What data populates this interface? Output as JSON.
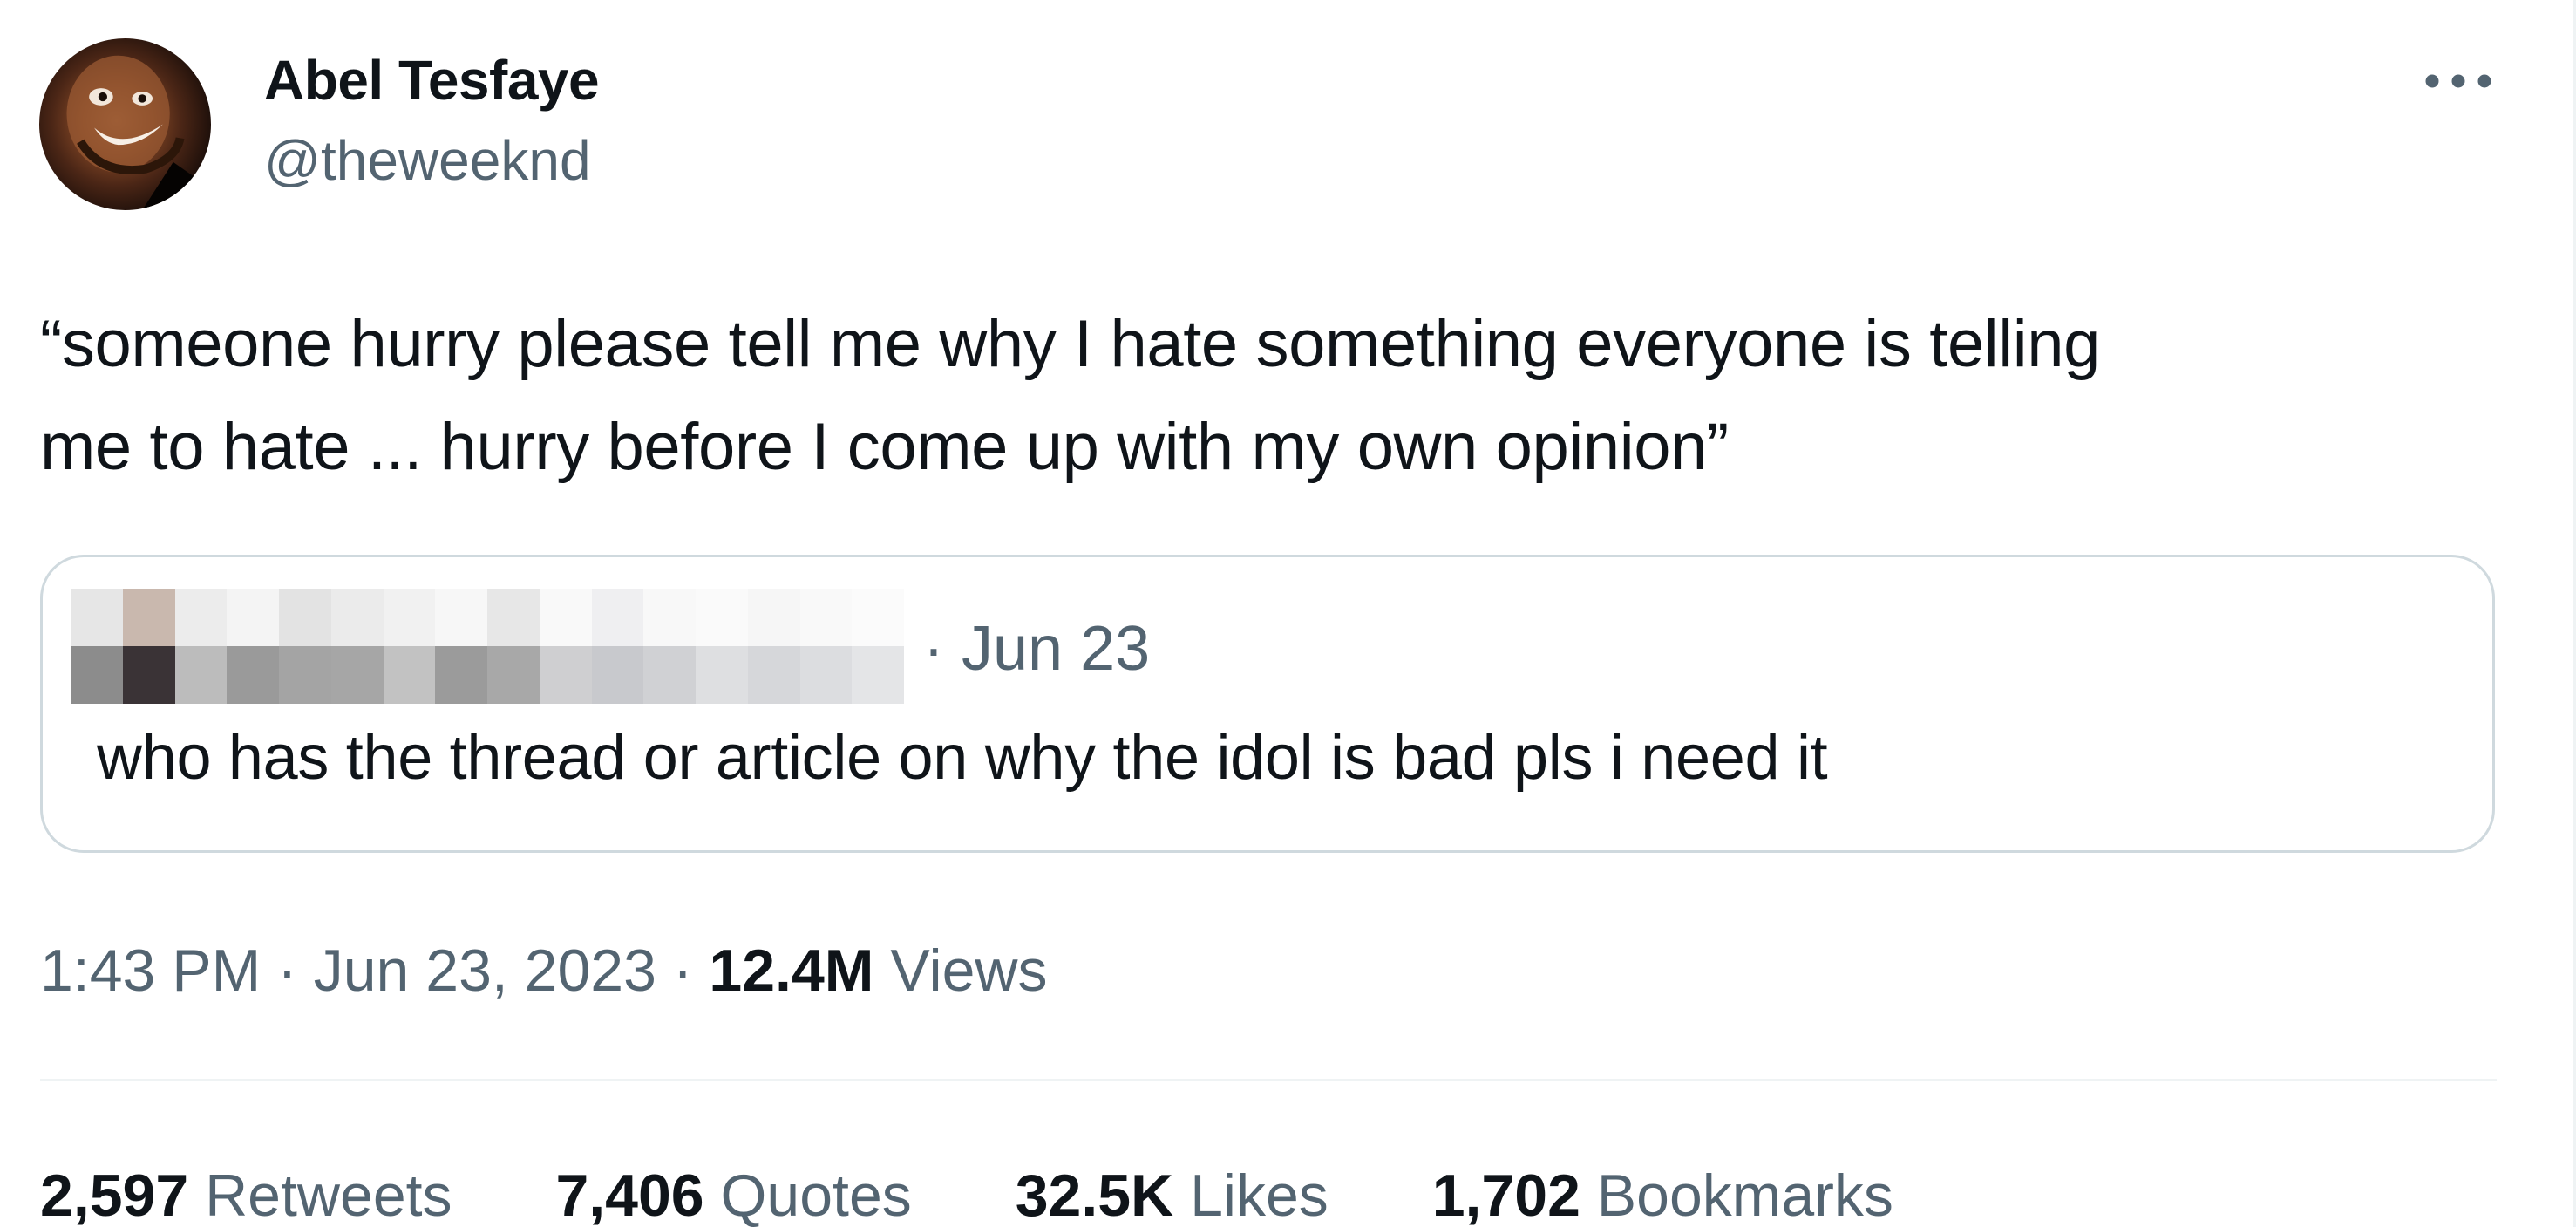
{
  "author": {
    "name": "Abel Tesfaye",
    "handle": "@theweeknd",
    "avatar_icon": "user-avatar-photo"
  },
  "more_icon": "more-horizontal-icon",
  "tweet": {
    "text_line_1": "“someone hurry please tell me why I hate something everyone is telling",
    "text_line_2": "me to hate ... hurry before I come up with my own opinion”"
  },
  "quoted_tweet": {
    "author_redacted": true,
    "date": "· Jun 23",
    "text": "who has the thread or article on why the idol is bad pls i need it"
  },
  "meta": {
    "time": "1:43 PM",
    "separator": "·",
    "date": "Jun 23, 2023",
    "views_count": "12.4M",
    "views_label": "Views"
  },
  "stats": {
    "retweets_count": "2,597",
    "retweets_label": "Retweets",
    "quotes_count": "7,406",
    "quotes_label": "Quotes",
    "likes_count": "32.5K",
    "likes_label": "Likes",
    "bookmarks_count": "1,702",
    "bookmarks_label": "Bookmarks"
  },
  "colors": {
    "text_primary": "#0f1419",
    "text_secondary": "#536471",
    "border": "#cfd9de",
    "divider": "#eff3f4"
  }
}
